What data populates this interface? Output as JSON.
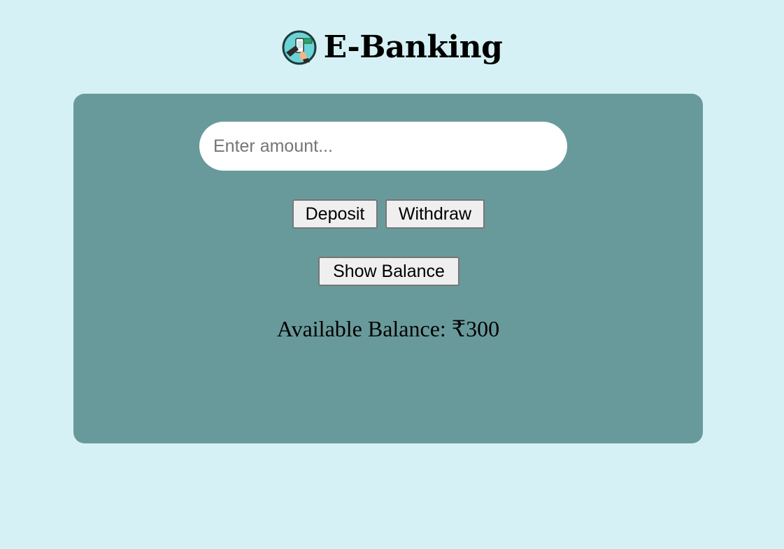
{
  "header": {
    "title": "E-Banking",
    "logo_icon": "mobile-banking-hand-icon"
  },
  "form": {
    "amount_placeholder": "Enter amount...",
    "amount_value": "",
    "deposit_label": "Deposit",
    "withdraw_label": "Withdraw",
    "show_balance_label": "Show Balance"
  },
  "balance": {
    "text": "Available Balance: ₹300"
  },
  "colors": {
    "page_background": "#d6f1f5",
    "panel_background": "#699a9b",
    "button_background": "#efefef"
  }
}
